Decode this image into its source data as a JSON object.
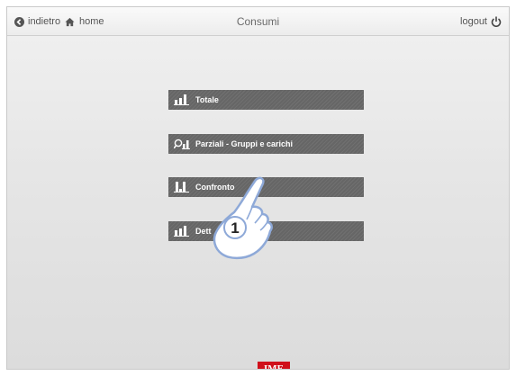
{
  "header": {
    "back_label": "indietro",
    "home_label": "home",
    "title": "Consumi",
    "logout_label": "logout"
  },
  "menu": {
    "items": [
      {
        "label": "Totale",
        "icon": "bar-chart-icon"
      },
      {
        "label": "Parziali - Gruppi e carichi",
        "icon": "magnify-chart-icon"
      },
      {
        "label": "Confronto",
        "icon": "compare-chart-icon"
      },
      {
        "label": "Dett",
        "icon": "bar-chart-icon"
      }
    ]
  },
  "annotation": {
    "step_number": "1",
    "icon": "pointing-hand-icon"
  },
  "footer": {
    "logo_text": "IME"
  },
  "colors": {
    "accent": "#d0101b",
    "button": "#6b6b6b",
    "title": "#6a6a6a"
  }
}
